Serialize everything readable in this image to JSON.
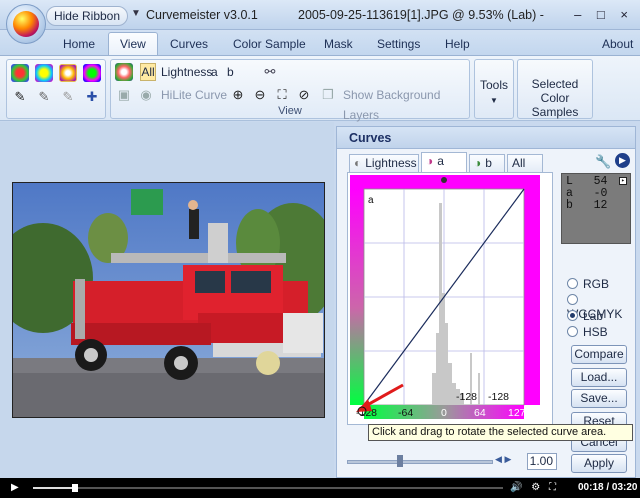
{
  "app": {
    "hide_ribbon": "Hide Ribbon",
    "title": "Curvemeister v3.0.1",
    "document": "2005-09-25-113619[1].JPG @ 9.53% (Lab) -",
    "window_buttons": "– □ ×"
  },
  "tabs": [
    {
      "label": "Home"
    },
    {
      "label": "View",
      "active": true
    },
    {
      "label": "Curves"
    },
    {
      "label": "Color Sample"
    },
    {
      "label": "Mask"
    },
    {
      "label": "Settings"
    },
    {
      "label": "Help"
    }
  ],
  "about": "About",
  "ribbon": {
    "view_group_label": "View",
    "channel_all": "All",
    "channel_lightness": "Lightness",
    "channel_a": "a",
    "channel_b": "b",
    "hilite_curve": "HiLite Curve",
    "show_background_layers": "Show Background Layers",
    "tools_label": "Tools",
    "selected_color_label": "Selected Color Samples"
  },
  "curves_panel": {
    "title": "Curves",
    "tabs": [
      {
        "label": "Lightness"
      },
      {
        "label": "a",
        "active": true
      },
      {
        "label": "b"
      },
      {
        "label": "All"
      }
    ],
    "graph_channel": "a",
    "axis_ticks": [
      "-128",
      "-64",
      "0",
      "64",
      "127"
    ],
    "readout_labels": [
      "-128",
      "-128"
    ],
    "readout": {
      "l_label": "L",
      "l_value": "54",
      "a_label": "a",
      "a_value": "-0",
      "b_label": "b",
      "b_value": "12"
    },
    "color_modes": [
      {
        "label": "RGB",
        "selected": false
      },
      {
        "label": "WGCMYK",
        "selected": false
      },
      {
        "label": "Lab",
        "selected": true
      },
      {
        "label": "HSB",
        "selected": false
      }
    ],
    "buttons": {
      "compare": "Compare",
      "load": "Load...",
      "save": "Save...",
      "reset": "Reset",
      "cancel": "Cancel",
      "apply": "Apply"
    },
    "slider_value": "1.00",
    "tooltip": "Click and drag to rotate the selected curve area."
  },
  "player": {
    "time": "00:18 / 03:20",
    "progress": 0.09
  }
}
